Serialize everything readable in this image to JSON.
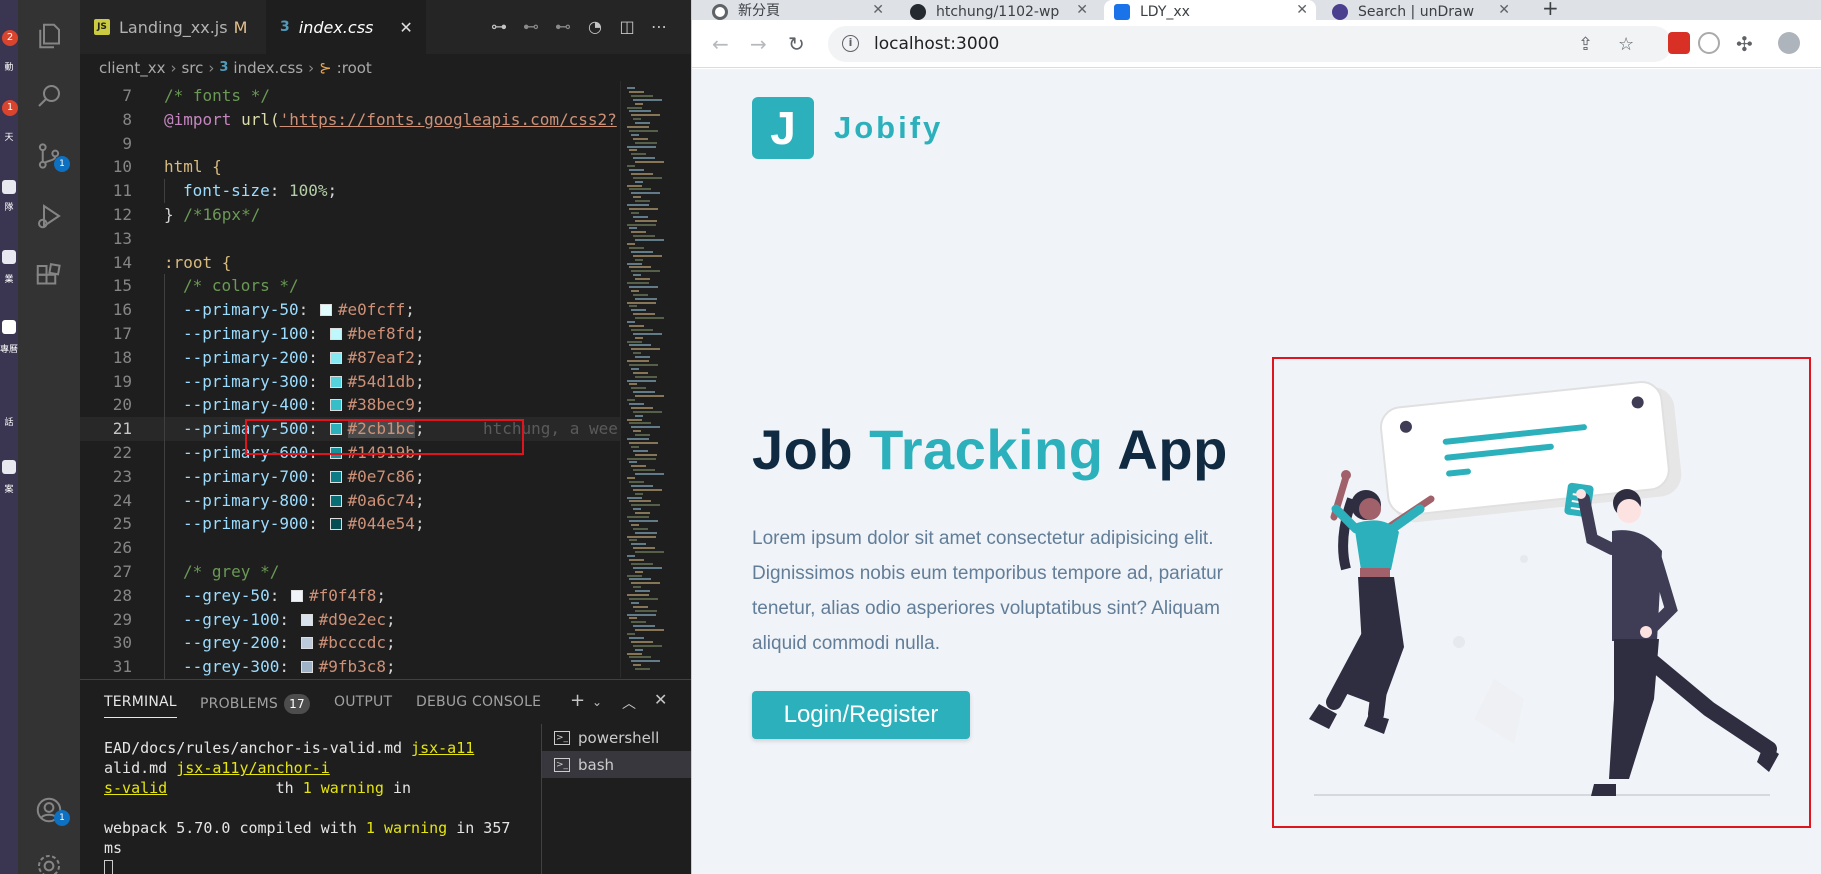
{
  "left_strip": {
    "badges": [
      "2",
      "1"
    ],
    "chars": [
      "動",
      "天",
      "隊",
      "業",
      "專曆",
      "話",
      "案"
    ]
  },
  "activity_bar": {
    "items": [
      {
        "name": "explorer-icon"
      },
      {
        "name": "search-icon"
      },
      {
        "name": "source-control-icon",
        "badge": "1"
      },
      {
        "name": "run-debug-icon"
      },
      {
        "name": "extensions-icon"
      }
    ],
    "bottom": [
      {
        "name": "account-icon",
        "badge": "1"
      },
      {
        "name": "settings-gear-icon"
      }
    ]
  },
  "editor": {
    "tabs": [
      {
        "label": "Landing_xx.js",
        "modified": "M",
        "icon": "JS",
        "active": false
      },
      {
        "label": "index.css",
        "icon": "css",
        "active": true
      }
    ],
    "breadcrumb": [
      "client_xx",
      "src",
      "index.css",
      ":root"
    ],
    "blame_text": "htchung, a wee",
    "lines": [
      {
        "n": "7"
      },
      {
        "n": "8"
      },
      {
        "n": "9"
      },
      {
        "n": "10"
      },
      {
        "n": "11"
      },
      {
        "n": "12"
      },
      {
        "n": "13"
      },
      {
        "n": "14"
      },
      {
        "n": "15"
      },
      {
        "n": "16"
      },
      {
        "n": "17"
      },
      {
        "n": "18"
      },
      {
        "n": "19"
      },
      {
        "n": "20"
      },
      {
        "n": "21"
      },
      {
        "n": "22"
      },
      {
        "n": "23"
      },
      {
        "n": "24"
      },
      {
        "n": "25"
      },
      {
        "n": "26"
      },
      {
        "n": "27"
      },
      {
        "n": "28"
      },
      {
        "n": "29"
      },
      {
        "n": "30"
      },
      {
        "n": "31"
      }
    ],
    "code": {
      "l7": "/* fonts */",
      "l8_kw": "@import",
      "l8_fn": " url(",
      "l8_str": "'https://fonts.googleapis.com/css2?",
      "l10": "html {",
      "l11_prop": "font-size",
      "l11_val": "100%",
      "l12_a": "} ",
      "l12_com": "/*16px*/",
      "l14": ":root {",
      "l15": "/* colors */",
      "vars": [
        {
          "name": "--primary-50",
          "value": "#e0fcff",
          "swatch": "#e0fcff"
        },
        {
          "name": "--primary-100",
          "value": "#bef8fd",
          "swatch": "#bef8fd"
        },
        {
          "name": "--primary-200",
          "value": "#87eaf2",
          "swatch": "#87eaf2"
        },
        {
          "name": "--primary-300",
          "value": "#54d1db",
          "swatch": "#54d1db"
        },
        {
          "name": "--primary-400",
          "value": "#38bec9",
          "swatch": "#38bec9"
        },
        {
          "name": "--primary-500",
          "value": "#2cb1bc",
          "swatch": "#2cb1bc"
        },
        {
          "name": "--primary-600",
          "value": "#14919b",
          "swatch": "#14919b"
        },
        {
          "name": "--primary-700",
          "value": "#0e7c86",
          "swatch": "#0e7c86"
        },
        {
          "name": "--primary-800",
          "value": "#0a6c74",
          "swatch": "#0a6c74"
        },
        {
          "name": "--primary-900",
          "value": "#044e54",
          "swatch": "#044e54"
        }
      ],
      "l27": "/* grey */",
      "grey_vars": [
        {
          "name": "--grey-50",
          "value": "#f0f4f8",
          "swatch": "#f0f4f8"
        },
        {
          "name": "--grey-100",
          "value": "#d9e2ec",
          "swatch": "#d9e2ec"
        },
        {
          "name": "--grey-200",
          "value": "#bcccdc",
          "swatch": "#bcccdc"
        },
        {
          "name": "--grey-300",
          "value": "#9fb3c8",
          "swatch": "#9fb3c8"
        }
      ]
    }
  },
  "panel": {
    "tabs": [
      {
        "label": "TERMINAL",
        "active": true
      },
      {
        "label": "PROBLEMS",
        "badge": "17"
      },
      {
        "label": "OUTPUT"
      },
      {
        "label": "DEBUG CONSOLE"
      }
    ],
    "terminal": {
      "l1_a": "EAD/docs/rules/anchor-is-valid.md  ",
      "l1_link": "jsx-a11",
      "l2_a": "alid.md  ",
      "l2_link": "jsx-a11y/anchor-i",
      "l3_link": "s-valid",
      "l3_b": "            th ",
      "l3_num": "1 warning",
      "l3_c": " in",
      "l5_a": "webpack 5.70.0 compiled with ",
      "l5_num": "1 warning",
      "l5_b": " in 357",
      "l6": " ms"
    },
    "shells": [
      {
        "label": "powershell"
      },
      {
        "label": "bash",
        "selected": true
      }
    ]
  },
  "browser": {
    "tabs": [
      {
        "label": "新分頁"
      },
      {
        "label": "htchung/1102-wp"
      },
      {
        "label": "LDY_xx",
        "active": true
      },
      {
        "label": "Search | unDraw"
      }
    ],
    "url": "localhost:3000",
    "page": {
      "logo_letter": "J",
      "logo_text": "Jobify",
      "title_1": "Job ",
      "title_accent": "Tracking",
      "title_2": " App",
      "body": "Lorem ipsum dolor sit amet consectetur adipisicing elit. Dignissimos nobis eum temporibus tempore ad, pariatur tenetur, alias odio asperiores voluptatibus sint? Aliquam aliquid commodi nulla.",
      "cta": "Login/Register"
    }
  },
  "colors": {
    "primary": "#2cb1bc",
    "dark": "#102a42",
    "highlight": "#e0141e"
  }
}
